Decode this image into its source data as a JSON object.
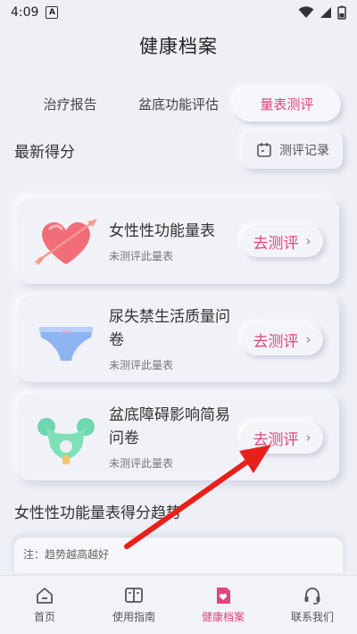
{
  "status_bar": {
    "time": "4:09",
    "notif_letter": "A"
  },
  "header": {
    "title": "健康档案"
  },
  "tabs": [
    {
      "label": "治疗报告"
    },
    {
      "label": "盆底功能评估"
    },
    {
      "label": "量表测评"
    }
  ],
  "section": {
    "label": "最新得分",
    "record_button": "测评记录"
  },
  "cards": [
    {
      "name": "女性性功能量表",
      "status": "未测评此量表",
      "action": "去测评"
    },
    {
      "name": "尿失禁生活质量问卷",
      "status": "未测评此量表",
      "action": "去测评"
    },
    {
      "name": "盆底障碍影响简易问卷",
      "status": "未测评此量表",
      "action": "去测评"
    }
  ],
  "trend": {
    "title": "女性性功能量表得分趋势",
    "note": "注：趋势越高越好"
  },
  "bottom_nav": [
    {
      "label": "首页",
      "icon": "home-icon"
    },
    {
      "label": "使用指南",
      "icon": "book-icon"
    },
    {
      "label": "健康档案",
      "icon": "health-record-icon"
    },
    {
      "label": "联系我们",
      "icon": "headset-icon"
    }
  ],
  "colors": {
    "accent": "#e0457b",
    "background": "#eef0f6",
    "arrow": "#e8201c"
  }
}
